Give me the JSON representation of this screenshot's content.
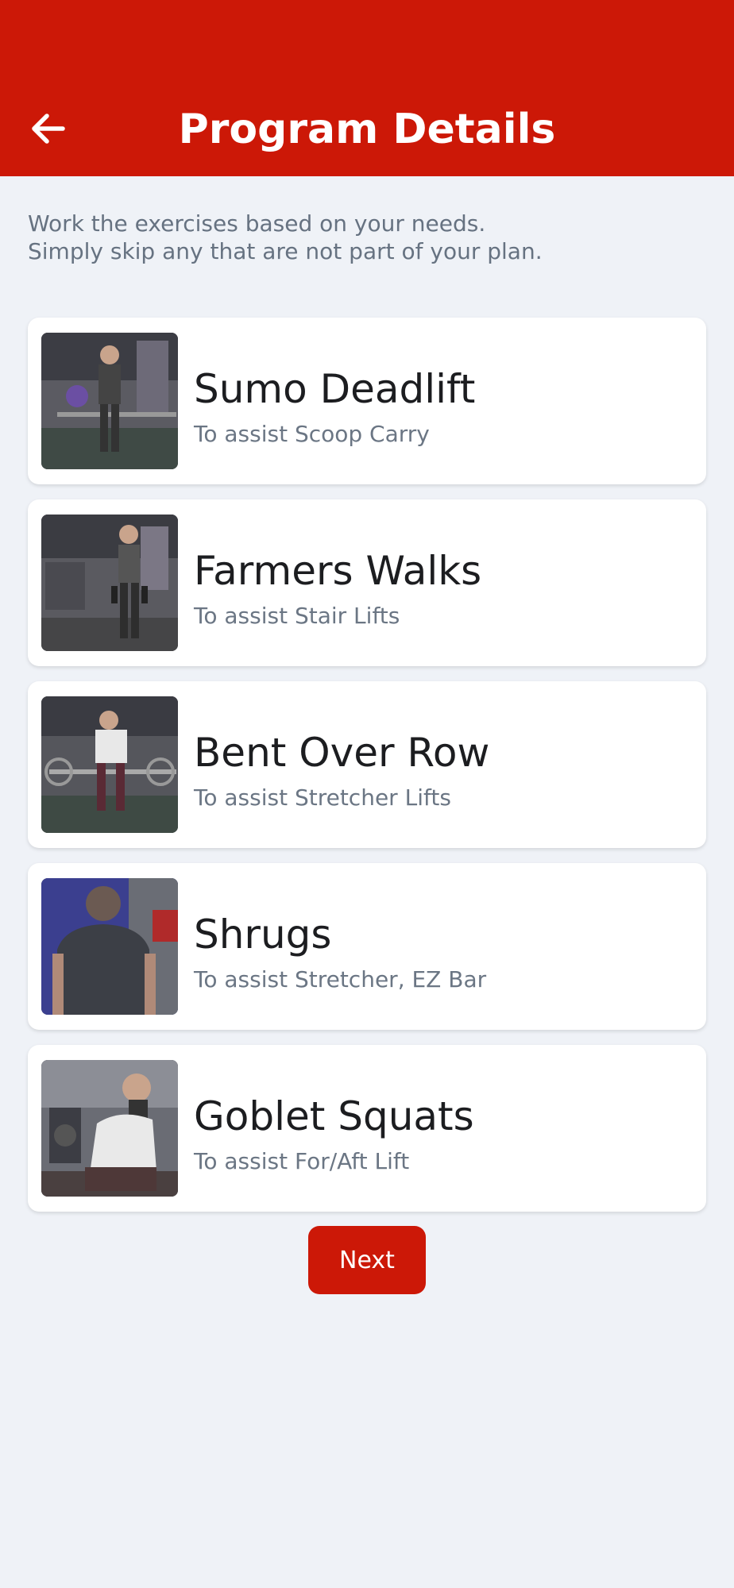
{
  "header": {
    "title": "Program Details",
    "back_icon": "arrow-left-icon",
    "color": "#cc1807"
  },
  "intro": {
    "line1": "Work the exercises based on your needs.",
    "line2": "Simply skip any that are not part of your plan."
  },
  "exercises": [
    {
      "title": "Sumo Deadlift",
      "subtitle": "To assist Scoop Carry",
      "thumb_icon": "exercise-photo-icon"
    },
    {
      "title": "Farmers Walks",
      "subtitle": "To assist Stair Lifts",
      "thumb_icon": "exercise-photo-icon"
    },
    {
      "title": "Bent Over Row",
      "subtitle": "To assist Stretcher Lifts",
      "thumb_icon": "exercise-photo-icon"
    },
    {
      "title": "Shrugs",
      "subtitle": "To assist Stretcher, EZ Bar",
      "thumb_icon": "exercise-photo-icon"
    },
    {
      "title": "Goblet Squats",
      "subtitle": "To assist For/Aft Lift",
      "thumb_icon": "exercise-photo-icon"
    }
  ],
  "actions": {
    "next_label": "Next"
  }
}
